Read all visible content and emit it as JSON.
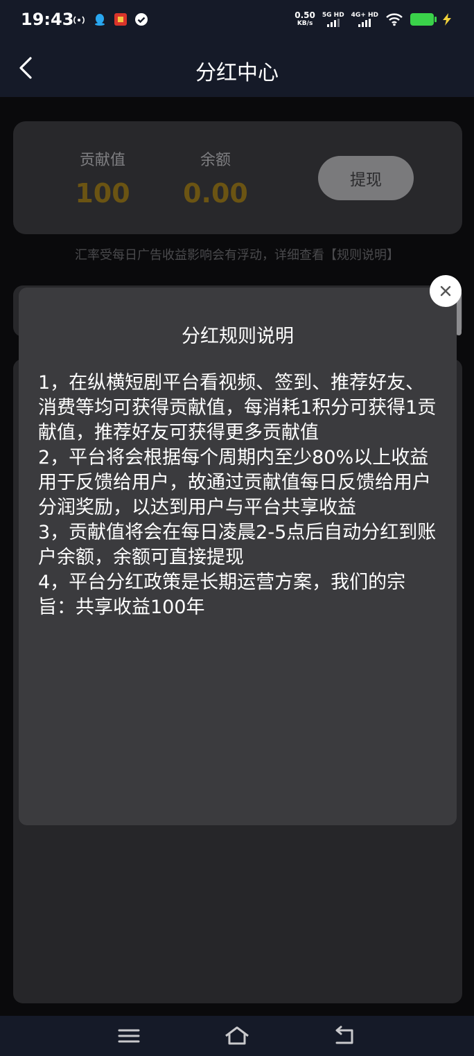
{
  "status_bar": {
    "time": "19:43",
    "net_speed_value": "0.50",
    "net_speed_unit": "KB/s",
    "sim1_label": "5G HD",
    "sim2_label": "4G+ HD",
    "battery_color": "#3ad24a"
  },
  "header": {
    "title": "分红中心"
  },
  "summary": {
    "contribution_label": "贡献值",
    "contribution_value": "100",
    "balance_label": "余额",
    "balance_value": "0.00",
    "withdraw_label": "提现",
    "value_color": "#6b5413"
  },
  "hint_text": "汇率受每日广告收益影响会有浮动，详细查看【规则说明】",
  "modal": {
    "title": "分红规则说明",
    "rules": [
      "1，在纵横短剧平台看视频、签到、推荐好友、消费等均可获得贡献值，每消耗1积分可获得1贡献值，推荐好友可获得更多贡献值",
      "2，平台将会根据每个周期内至少80%以上收益用于反馈给用户，故通过贡献值每日反馈给用户分润奖励，以达到用户与平台共享收益",
      "3，贡献值将会在每日凌晨2-5点后自动分红到账户余额，余额可直接提现",
      "4，平台分红政策是长期运营方案，我们的宗旨：共享收益100年"
    ]
  },
  "navbar": {
    "icons": [
      "menu-icon",
      "home-icon",
      "back-icon"
    ]
  }
}
